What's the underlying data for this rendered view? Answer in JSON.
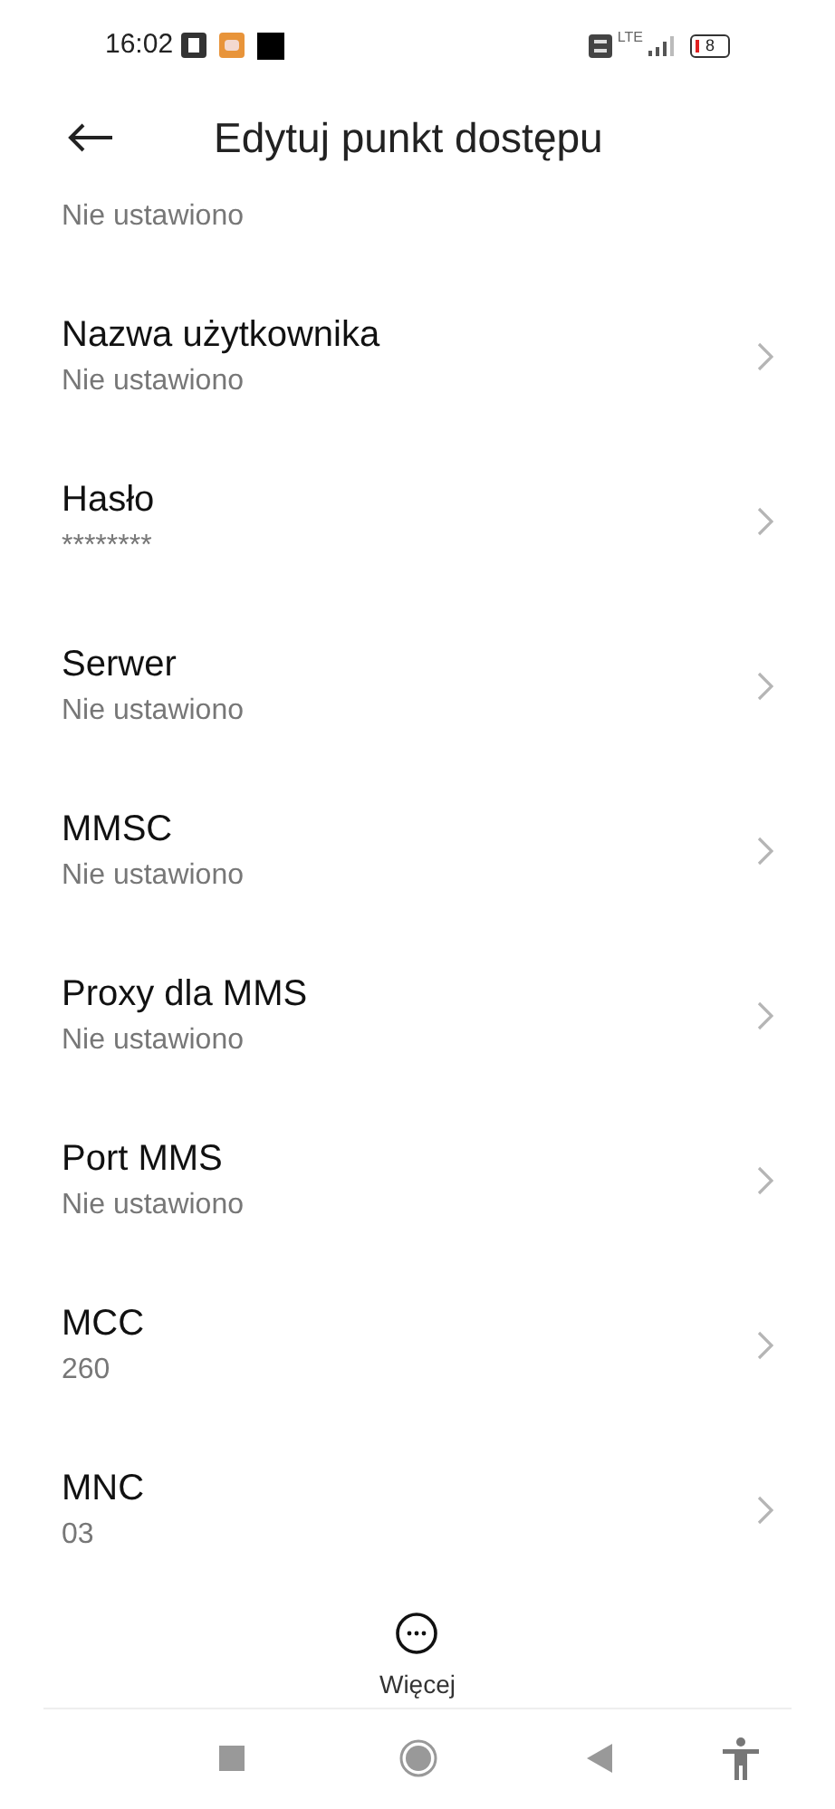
{
  "status_bar": {
    "time": "16:02",
    "network": "LTE",
    "battery": "8"
  },
  "header": {
    "title": "Edytuj punkt dostępu"
  },
  "partial_item_value": "Nie ustawiono",
  "items": [
    {
      "title": "Nazwa użytkownika",
      "value": "Nie ustawiono"
    },
    {
      "title": "Hasło",
      "value": "********"
    },
    {
      "title": "Serwer",
      "value": "Nie ustawiono"
    },
    {
      "title": "MMSC",
      "value": "Nie ustawiono"
    },
    {
      "title": "Proxy dla MMS",
      "value": "Nie ustawiono"
    },
    {
      "title": "Port MMS",
      "value": "Nie ustawiono"
    },
    {
      "title": "MCC",
      "value": "260"
    },
    {
      "title": "MNC",
      "value": "03"
    }
  ],
  "more_button": {
    "label": "Więcej"
  }
}
